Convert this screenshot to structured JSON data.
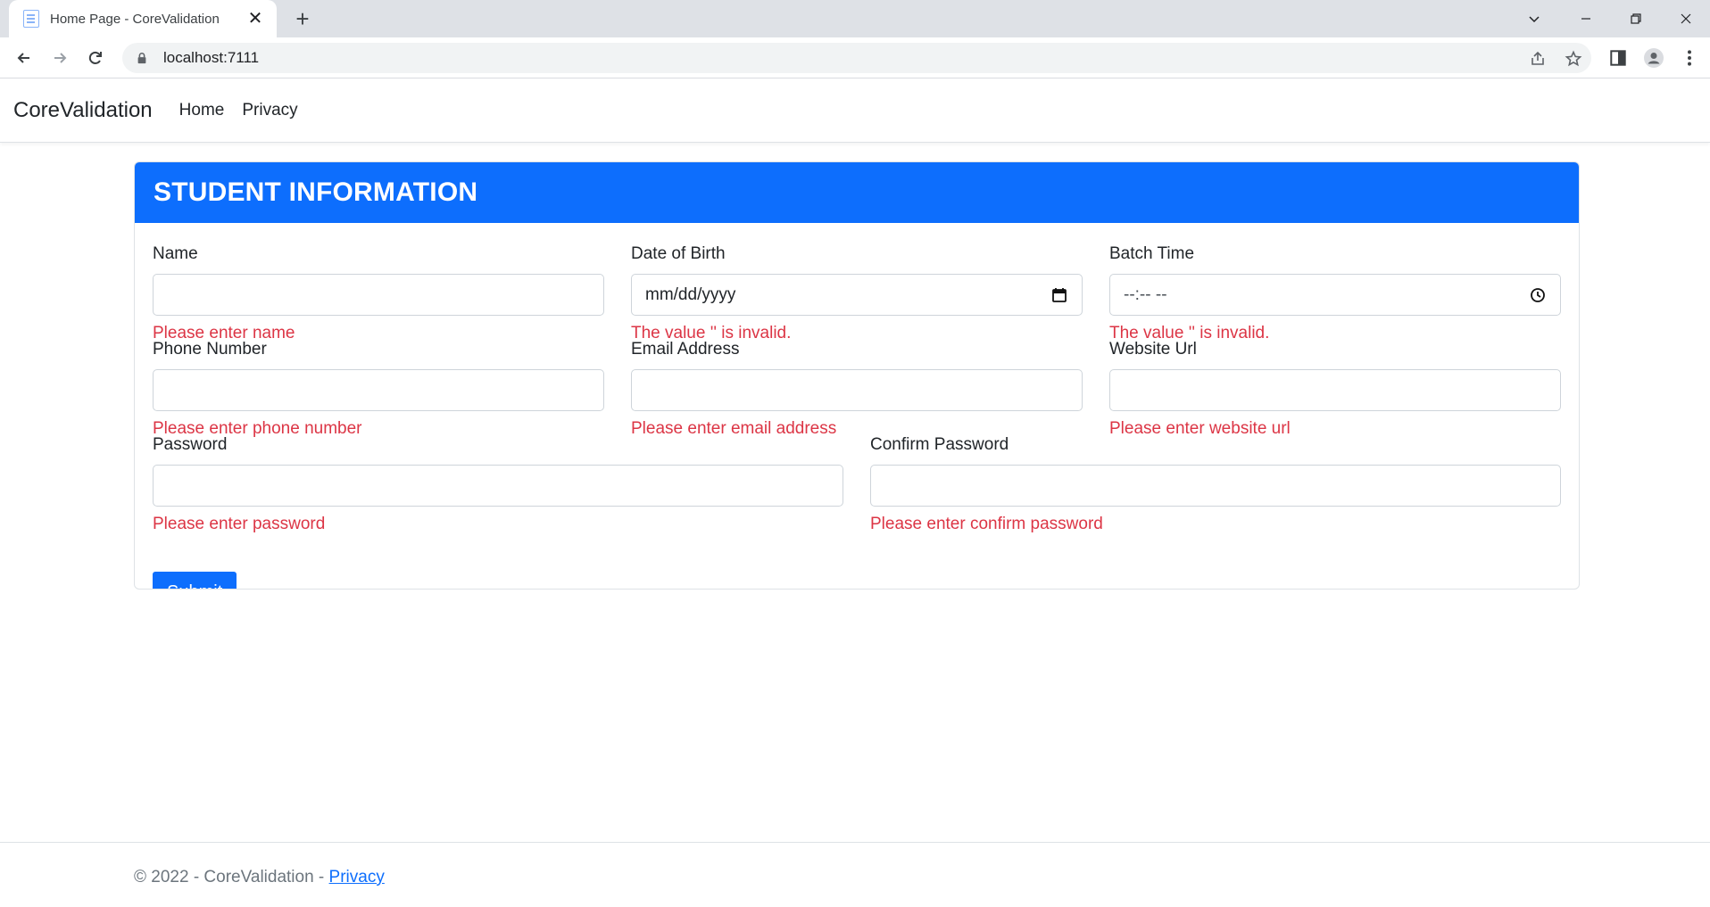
{
  "browser": {
    "tab_title": "Home Page - CoreValidation",
    "new_tab": "+",
    "close": "✕",
    "url": "localhost:7111"
  },
  "navbar": {
    "brand": "CoreValidation",
    "links": [
      "Home",
      "Privacy"
    ]
  },
  "card": {
    "title": "STUDENT INFORMATION"
  },
  "form": {
    "name": {
      "label": "Name",
      "value": "",
      "error": "Please enter name"
    },
    "dob": {
      "label": "Date of Birth",
      "placeholder": "mm/dd/yyyy",
      "error": "The value '' is invalid."
    },
    "batch_time": {
      "label": "Batch Time",
      "placeholder": "--:-- --",
      "error": "The value '' is invalid."
    },
    "phone": {
      "label": "Phone Number",
      "value": "",
      "error": "Please enter phone number"
    },
    "email": {
      "label": "Email Address",
      "value": "",
      "error": "Please enter email address"
    },
    "website": {
      "label": "Website Url",
      "value": "",
      "error": "Please enter website url"
    },
    "password": {
      "label": "Password",
      "value": "",
      "error": "Please enter password"
    },
    "confirm_password": {
      "label": "Confirm Password",
      "value": "",
      "error": "Please enter confirm password"
    },
    "submit_label": "Submit"
  },
  "footer": {
    "text": "© 2022 - CoreValidation - ",
    "link": "Privacy"
  },
  "colors": {
    "primary": "#0d6efd",
    "error": "#dc3545"
  }
}
